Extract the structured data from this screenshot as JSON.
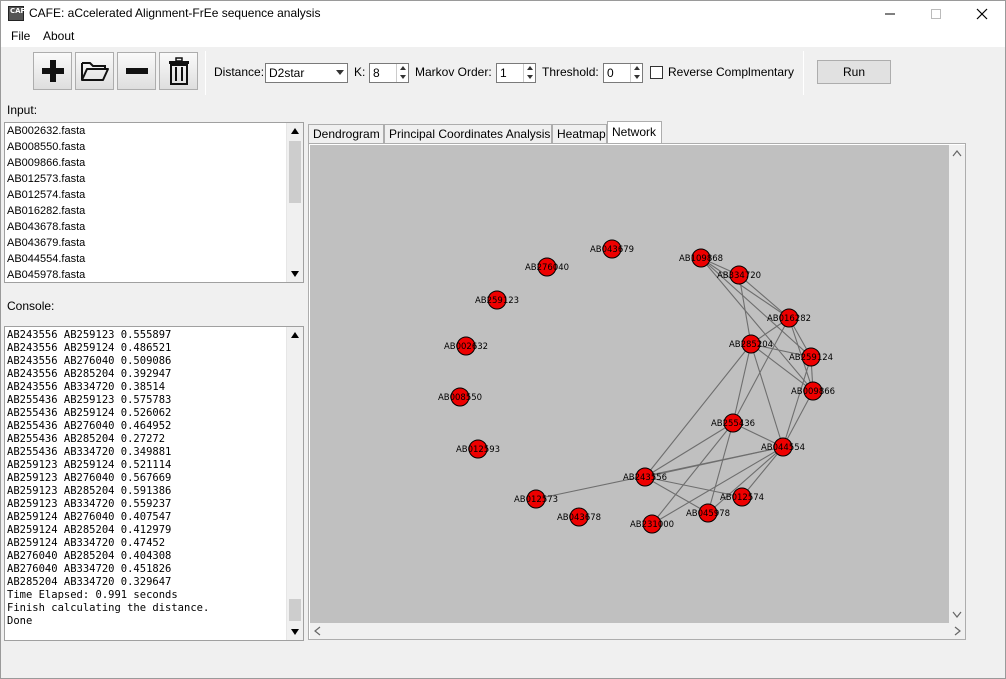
{
  "window": {
    "title": "CAFE: aCcelerated Alignment-FrEe sequence analysis",
    "icon_text": "CAFE"
  },
  "menu": [
    "File",
    "About"
  ],
  "toolbar": {
    "buttons": [
      {
        "name": "add-button",
        "icon": "plus-icon"
      },
      {
        "name": "open-button",
        "icon": "folder-open-icon"
      },
      {
        "name": "remove-button",
        "icon": "minus-icon"
      },
      {
        "name": "delete-button",
        "icon": "trash-icon"
      }
    ],
    "distance_label": "Distance:",
    "distance_value": "D2star",
    "k_label": "K:",
    "k_value": "8",
    "markov_label": "Markov Order:",
    "markov_value": "1",
    "threshold_label": "Threshold:",
    "threshold_value": "0",
    "reverse_label": "Reverse Complmentary",
    "reverse_checked": false,
    "run_label": "Run"
  },
  "input": {
    "label": "Input:",
    "files": [
      "AB002632.fasta",
      "AB008550.fasta",
      "AB009866.fasta",
      "AB012573.fasta",
      "AB012574.fasta",
      "AB016282.fasta",
      "AB043678.fasta",
      "AB043679.fasta",
      "AB044554.fasta",
      "AB045978.fasta"
    ]
  },
  "console": {
    "label": "Console:",
    "lines": [
      "AB243556 AB259123 0.555897",
      "AB243556 AB259124 0.486521",
      "AB243556 AB276040 0.509086",
      "AB243556 AB285204 0.392947",
      "AB243556 AB334720 0.38514",
      "AB255436 AB259123 0.575783",
      "AB255436 AB259124 0.526062",
      "AB255436 AB276040 0.464952",
      "AB255436 AB285204 0.27272",
      "AB255436 AB334720 0.349881",
      "AB259123 AB259124 0.521114",
      "AB259123 AB276040 0.567669",
      "AB259123 AB285204 0.591386",
      "AB259123 AB334720 0.559237",
      "AB259124 AB276040 0.407547",
      "AB259124 AB285204 0.412979",
      "AB259124 AB334720 0.47452",
      "AB276040 AB285204 0.404308",
      "AB276040 AB334720 0.451826",
      "AB285204 AB334720 0.329647",
      "Time Elapsed: 0.991 seconds",
      "Finish calculating the distance.",
      "Done"
    ]
  },
  "tabs": [
    "Dendrogram",
    "Principal Coordinates Analysis",
    "Heatmap",
    "Network"
  ],
  "active_tab": "Network",
  "network": {
    "nodes": [
      {
        "id": "AB043679",
        "label": "AB043679"
      },
      {
        "id": "AB276040",
        "label": "AB276040"
      },
      {
        "id": "AB009868",
        "label": "AB109868"
      },
      {
        "id": "AB334720",
        "label": "AB334720"
      },
      {
        "id": "AB259123",
        "label": "AB259123"
      },
      {
        "id": "AB016282",
        "label": "AB016282"
      },
      {
        "id": "AB285204",
        "label": "AB285204"
      },
      {
        "id": "AB259124",
        "label": "AB259124"
      },
      {
        "id": "AB002632",
        "label": "AB002632"
      },
      {
        "id": "AB009866",
        "label": "AB009866"
      },
      {
        "id": "AB008550",
        "label": "AB008550"
      },
      {
        "id": "AB255436",
        "label": "AB255436"
      },
      {
        "id": "AB044554",
        "label": "AB044554"
      },
      {
        "id": "AB012593",
        "label": "AB012593"
      },
      {
        "id": "AB243556",
        "label": "AB243556"
      },
      {
        "id": "AB012574",
        "label": "AB012574"
      },
      {
        "id": "AB012573",
        "label": "AB012573"
      },
      {
        "id": "AB045978",
        "label": "AB045978"
      },
      {
        "id": "AB043678",
        "label": "AB043678"
      },
      {
        "id": "AB231000",
        "label": "AB231000"
      }
    ],
    "edges": [
      [
        "AB009868",
        "AB334720"
      ],
      [
        "AB009868",
        "AB016282"
      ],
      [
        "AB009868",
        "AB259124"
      ],
      [
        "AB009868",
        "AB009866"
      ],
      [
        "AB334720",
        "AB016282"
      ],
      [
        "AB334720",
        "AB285204"
      ],
      [
        "AB016282",
        "AB285204"
      ],
      [
        "AB016282",
        "AB259124"
      ],
      [
        "AB016282",
        "AB009866"
      ],
      [
        "AB016282",
        "AB255436"
      ],
      [
        "AB285204",
        "AB259124"
      ],
      [
        "AB285204",
        "AB009866"
      ],
      [
        "AB285204",
        "AB255436"
      ],
      [
        "AB285204",
        "AB044554"
      ],
      [
        "AB285204",
        "AB243556"
      ],
      [
        "AB259124",
        "AB009866"
      ],
      [
        "AB259124",
        "AB044554"
      ],
      [
        "AB009866",
        "AB044554"
      ],
      [
        "AB255436",
        "AB044554"
      ],
      [
        "AB255436",
        "AB243556"
      ],
      [
        "AB255436",
        "AB045978"
      ],
      [
        "AB255436",
        "AB231000"
      ],
      [
        "AB044554",
        "AB243556"
      ],
      [
        "AB044554",
        "AB012574"
      ],
      [
        "AB044554",
        "AB045978"
      ],
      [
        "AB044554",
        "AB012573"
      ],
      [
        "AB044554",
        "AB231000"
      ],
      [
        "AB243556",
        "AB045978"
      ],
      [
        "AB243556",
        "AB012574"
      ]
    ]
  }
}
